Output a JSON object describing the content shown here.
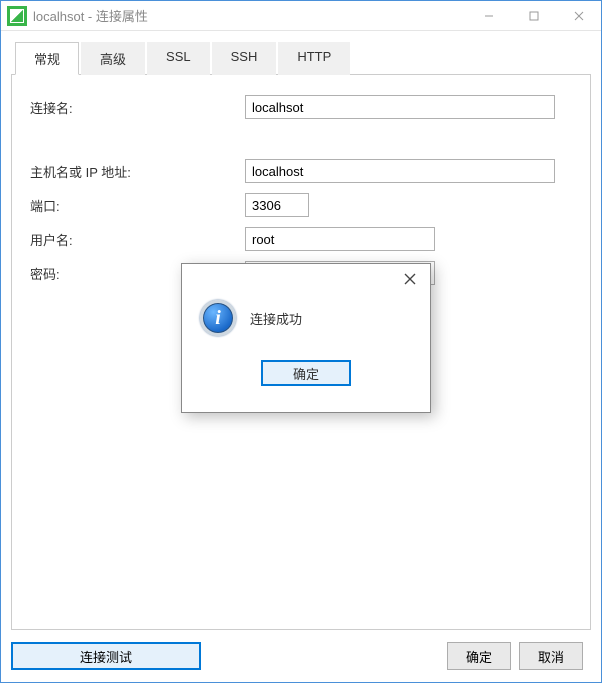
{
  "window": {
    "title": "localhsot - 连接属性"
  },
  "tabs": {
    "general": "常规",
    "advanced": "高级",
    "ssl": "SSL",
    "ssh": "SSH",
    "http": "HTTP"
  },
  "form": {
    "connection_name_label": "连接名:",
    "connection_name_value": "localhsot",
    "host_label": "主机名或 IP 地址:",
    "host_value": "localhost",
    "port_label": "端口:",
    "port_value": "3306",
    "user_label": "用户名:",
    "user_value": "root",
    "password_label": "密码:",
    "password_value": ""
  },
  "footer": {
    "test_label": "连接测试",
    "ok_label": "确定",
    "cancel_label": "取消"
  },
  "modal": {
    "message": "连接成功",
    "ok_label": "确定"
  }
}
